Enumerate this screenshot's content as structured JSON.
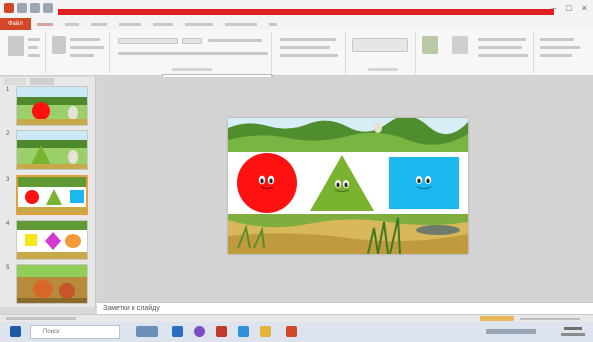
{
  "window": {
    "controls": [
      "–",
      "□",
      "×"
    ]
  },
  "tabs": {
    "file": "Файл"
  },
  "notes": {
    "placeholder": "Заметки к слайду"
  },
  "taskbar": {
    "search_placeholder": "Поиск"
  },
  "slides": [
    {
      "number": "1"
    },
    {
      "number": "2"
    },
    {
      "number": "3"
    },
    {
      "number": "4"
    },
    {
      "number": "5"
    }
  ],
  "colors": {
    "accent": "#d24726",
    "title_strip": "#e02020",
    "circle": "#ff1111",
    "triangle": "#7ab330",
    "square": "#1ab8ee",
    "selection": "#e8a03c"
  }
}
